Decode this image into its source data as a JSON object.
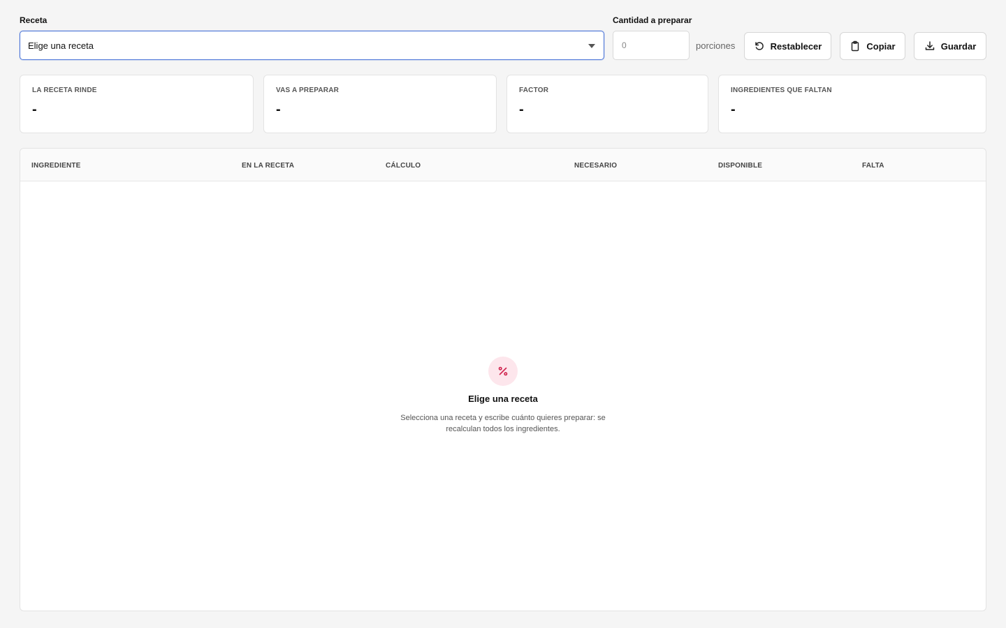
{
  "form": {
    "recipe_label": "Receta",
    "recipe_selected": "Elige una receta",
    "quantity_label": "Cantidad a preparar",
    "quantity_placeholder": "0",
    "quantity_unit": "porciones"
  },
  "actions": {
    "reset_label": "Restablecer",
    "copy_label": "Copiar",
    "save_label": "Guardar"
  },
  "stats": [
    {
      "label": "LA RECETA RINDE",
      "value": "-"
    },
    {
      "label": "VAS A PREPARAR",
      "value": "-"
    },
    {
      "label": "FACTOR",
      "value": "-"
    },
    {
      "label": "INGREDIENTES QUE FALTAN",
      "value": "-"
    }
  ],
  "table": {
    "columns": [
      "INGREDIENTE",
      "EN LA RECETA",
      "CÁLCULO",
      "NECESARIO",
      "DISPONIBLE",
      "FALTA"
    ]
  },
  "empty_state": {
    "icon": "percent-icon",
    "title": "Elige una receta",
    "description": "Selecciona una receta y escribe cuánto quieres preparar: se recalculan todos los ingredientes."
  },
  "colors": {
    "accent": "#4a74d8",
    "empty_icon_bg": "#fde6ec",
    "empty_icon_fg": "#d0254f"
  }
}
